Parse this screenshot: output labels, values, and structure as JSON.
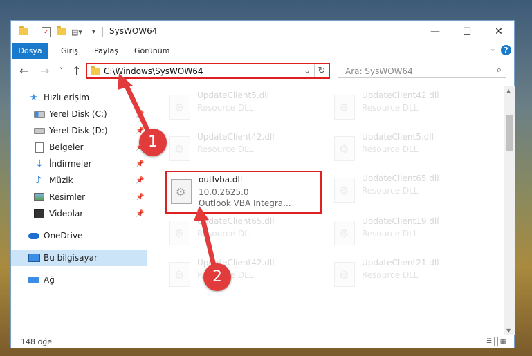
{
  "window": {
    "title": "SysWOW64",
    "controls": {
      "minimize": "—",
      "maximize": "☐",
      "close": "✕"
    }
  },
  "ribbon": {
    "tabs": [
      "Dosya",
      "Giriş",
      "Paylaş",
      "Görünüm"
    ],
    "help": "?",
    "expand": "⌄"
  },
  "nav": {
    "back": "←",
    "forward": "→",
    "recent": "˅",
    "up": "↑",
    "address": "C:\\Windows\\SysWOW64",
    "address_dropdown": "⌄",
    "refresh": "↻",
    "search_placeholder": "Ara: SysWOW64",
    "search_icon": "⌕"
  },
  "sidebar": {
    "items": [
      {
        "label": "Hızlı erişim",
        "icon": "star-icon"
      },
      {
        "label": "Yerel Disk (C:)",
        "icon": "drive-icon"
      },
      {
        "label": "Yerel Disk (D:)",
        "icon": "drive-icon"
      },
      {
        "label": "Belgeler",
        "icon": "document-icon"
      },
      {
        "label": "İndirmeler",
        "icon": "download-icon"
      },
      {
        "label": "Müzik",
        "icon": "music-icon"
      },
      {
        "label": "Resimler",
        "icon": "pictures-icon"
      },
      {
        "label": "Videolar",
        "icon": "video-icon"
      },
      {
        "label": "OneDrive",
        "icon": "cloud-icon"
      },
      {
        "label": "Bu bilgisayar",
        "icon": "computer-icon"
      },
      {
        "label": "Ağ",
        "icon": "network-icon"
      }
    ],
    "pin_glyph": "📌"
  },
  "files": [
    {
      "name": "UpdateClient5.dll",
      "line2": "Resource DLL",
      "line3": ""
    },
    {
      "name": "UpdateClient42.dll",
      "line2": "Resource DLL",
      "line3": ""
    },
    {
      "name": "UpdateClient42.dll",
      "line2": "Resource DLL",
      "line3": ""
    },
    {
      "name": "UpdateClient5.dll",
      "line2": "Resource DLL",
      "line3": ""
    },
    {
      "name": "outlvba.dll",
      "line2": "10.0.2625.0",
      "line3": "Outlook VBA Integra..."
    },
    {
      "name": "UpdateClient65.dll",
      "line2": "Resource DLL",
      "line3": ""
    },
    {
      "name": "UpdateClient65.dll",
      "line2": "Resource DLL",
      "line3": ""
    },
    {
      "name": "UpdateClient19.dll",
      "line2": "Resource DLL",
      "line3": ""
    },
    {
      "name": "UpdateClient42.dll",
      "line2": "Resource DLL",
      "line3": ""
    },
    {
      "name": "UpdateClient21.dll",
      "line2": "Resource DLL",
      "line3": ""
    }
  ],
  "status": {
    "count": "148 öğe",
    "details_view": "☰",
    "tiles_view": "▦"
  },
  "annotations": {
    "step1": "1",
    "step2": "2"
  },
  "colors": {
    "accent": "#1979ca",
    "highlight": "#e02020",
    "callout": "#e23b3b"
  }
}
